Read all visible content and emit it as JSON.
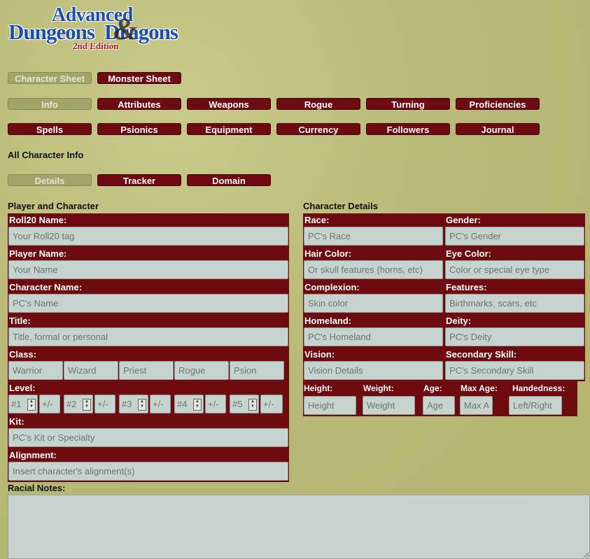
{
  "logo": {
    "line1": "Advanced",
    "line2": "Dungeons",
    "line2b": "Dragons",
    "edition": "2nd Edition"
  },
  "sheet_tabs": [
    {
      "label": "Character Sheet",
      "active": true
    },
    {
      "label": "Monster Sheet",
      "active": false
    }
  ],
  "section_tabs_row1": [
    "Info",
    "Attributes",
    "Weapons",
    "Rogue",
    "Turning",
    "Proficiencies"
  ],
  "section_tabs_row2": [
    "Spells",
    "Psionics",
    "Equipment",
    "Currency",
    "Followers",
    "Journal"
  ],
  "section_title": "All Character Info",
  "sub_tabs": [
    "Details",
    "Tracker",
    "Domain"
  ],
  "player_section": {
    "title": "Player and Character",
    "fields": {
      "roll20_name": {
        "label": "Roll20 Name:",
        "placeholder": "Your Roll20 tag"
      },
      "player_name": {
        "label": "Player Name:",
        "placeholder": "Your Name"
      },
      "character_name": {
        "label": "Character Name:",
        "placeholder": "PC's Name"
      },
      "title": {
        "label": "Title:",
        "placeholder": "Title, formal or personal"
      },
      "class": {
        "label": "Class:",
        "placeholders": [
          "Warrior",
          "Wizard",
          "Priest",
          "Rogue",
          "Psion"
        ]
      },
      "level": {
        "label": "Level:",
        "placeholders": [
          "#1",
          "#2",
          "#3",
          "#4",
          "#5"
        ],
        "mod_placeholder": "+/-"
      },
      "kit": {
        "label": "Kit:",
        "placeholder": "PC's Kit or Specialty"
      },
      "alignment": {
        "label": "Alignment:",
        "placeholder": "Insert character's alignment(s)"
      }
    }
  },
  "racial_notes_label": "Racial Notes:",
  "details_section": {
    "title": "Character Details",
    "fields": {
      "race": {
        "label": "Race:",
        "placeholder": "PC's Race"
      },
      "gender": {
        "label": "Gender:",
        "placeholder": "PC's Gender"
      },
      "hair": {
        "label": "Hair Color:",
        "placeholder": "Or skull features (horns, etc)"
      },
      "eye": {
        "label": "Eye Color:",
        "placeholder": "Color or special eye type"
      },
      "complexion": {
        "label": "Complexion:",
        "placeholder": "Skin color"
      },
      "features": {
        "label": "Features:",
        "placeholder": "Birthmarks, scars, etc"
      },
      "homeland": {
        "label": "Homeland:",
        "placeholder": "PC's Homeland"
      },
      "deity": {
        "label": "Deity:",
        "placeholder": "PC's Deity"
      },
      "vision": {
        "label": "Vision:",
        "placeholder": "Vision Details"
      },
      "secondary_skill": {
        "label": "Secondary Skill:",
        "placeholder": "PC's Secondary Skill"
      },
      "height": {
        "label": "Height:",
        "placeholder": "Height"
      },
      "weight": {
        "label": "Weight:",
        "placeholder": "Weight"
      },
      "age": {
        "label": "Age:",
        "placeholder": "Age"
      },
      "max_age": {
        "label": "Max Age:",
        "placeholder": "Max A"
      },
      "handedness": {
        "label": "Handedness:",
        "placeholder": "Left/Right"
      }
    }
  }
}
